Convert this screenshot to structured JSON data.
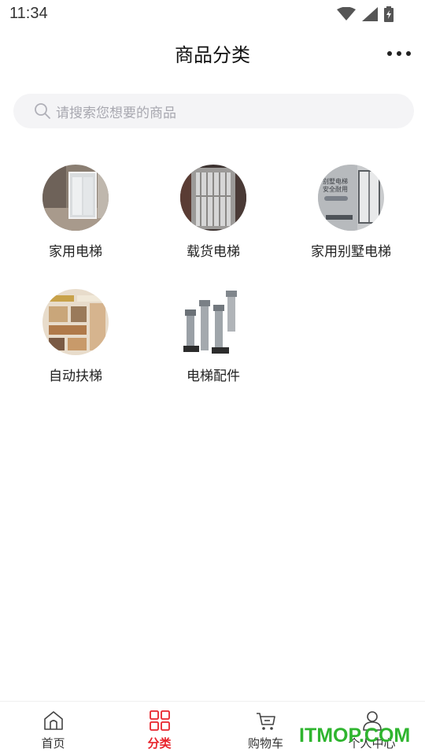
{
  "status_bar": {
    "time": "11:34"
  },
  "header": {
    "title": "商品分类"
  },
  "search": {
    "placeholder": "请搜索您想要的商品"
  },
  "categories": [
    {
      "label": "家用电梯",
      "image": "home-elevator-photo"
    },
    {
      "label": "载货电梯",
      "image": "freight-elevator-photo"
    },
    {
      "label": "家用别墅电梯",
      "image": "villa-elevator-photo"
    },
    {
      "label": "自动扶梯",
      "image": "escalator-photo"
    },
    {
      "label": "电梯配件",
      "image": "elevator-parts-photo"
    }
  ],
  "villa_thumb_text": [
    "别墅电梯",
    "安全耐用"
  ],
  "tabs": [
    {
      "label": "首页",
      "icon": "home-icon",
      "active": false
    },
    {
      "label": "分类",
      "icon": "grid-icon",
      "active": true
    },
    {
      "label": "购物车",
      "icon": "cart-icon",
      "active": false
    },
    {
      "label": "个人中心",
      "icon": "user-icon",
      "active": false
    }
  ],
  "watermark": "ITMOP.COM",
  "colors": {
    "accent": "#e8242c",
    "search_bg": "#f4f4f6",
    "watermark": "#2fb52f"
  }
}
